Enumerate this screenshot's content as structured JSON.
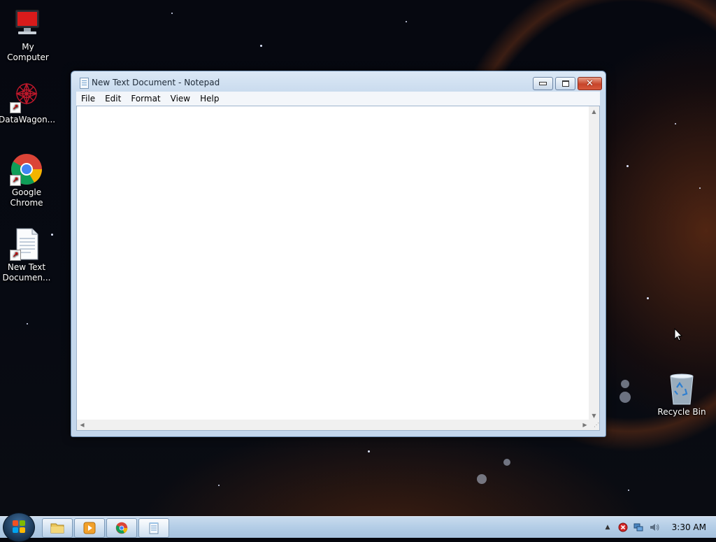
{
  "desktop": {
    "icons": [
      {
        "label": "My Computer",
        "icon": "computer-icon"
      },
      {
        "label": "DataWagon...",
        "icon": "datawagon-icon"
      },
      {
        "label": "Google Chrome",
        "icon": "chrome-icon"
      },
      {
        "label": "New Text Documen...",
        "icon": "text-document-icon"
      },
      {
        "label": "Recycle Bin",
        "icon": "recycle-bin-icon"
      }
    ]
  },
  "window": {
    "title": "New Text Document - Notepad",
    "menu": [
      "File",
      "Edit",
      "Format",
      "View",
      "Help"
    ],
    "content": ""
  },
  "taskbar": {
    "items": [
      "folder-icon",
      "media-player-icon",
      "chrome-icon",
      "notepad-icon"
    ],
    "clock": "3:30 AM"
  },
  "colors": {
    "accent": "#6a8cb0",
    "close": "#c7452a"
  }
}
